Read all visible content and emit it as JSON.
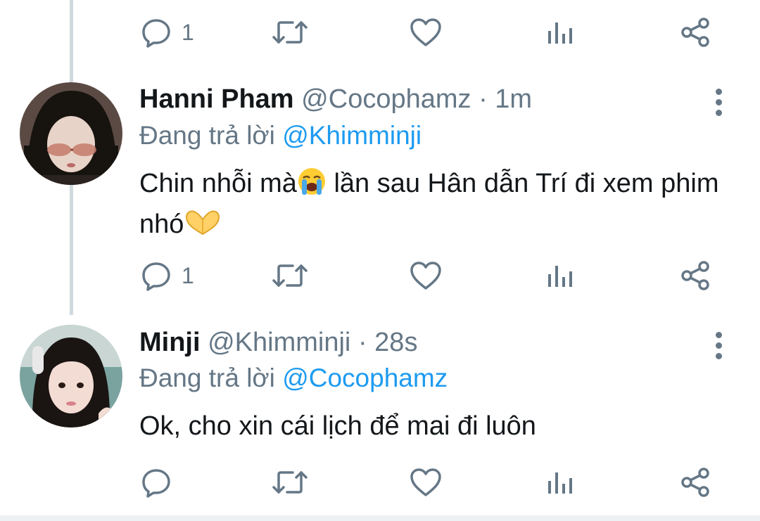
{
  "colors": {
    "accent": "#1d9bf0",
    "muted": "#657786",
    "text": "#14171a",
    "thread_line": "#cfd9de"
  },
  "top_actions": {
    "reply_count": "1"
  },
  "tweets": [
    {
      "display_name": "Hanni Pham",
      "handle": "@Cocophamz",
      "separator": "·",
      "time": "1m",
      "replying_prefix": "Đang trả lời",
      "replying_to": "@Khimminji",
      "text_part1": "Chin nhỗi mà",
      "emoji1": "loudly-crying-face",
      "text_part2": " lần sau Hân dẫn Trí đi xem phim nhó",
      "emoji2": "heart-hands",
      "reply_count": "1"
    },
    {
      "display_name": "Minji",
      "handle": "@Khimminji",
      "separator": "·",
      "time": "28s",
      "replying_prefix": "Đang trả lời",
      "replying_to": "@Cocophamz",
      "text": "Ok, cho xin cái lịch để mai đi luôn",
      "reply_count": ""
    }
  ],
  "icons": [
    "reply-icon",
    "retweet-icon",
    "like-icon",
    "views-icon",
    "share-icon",
    "more-icon"
  ]
}
